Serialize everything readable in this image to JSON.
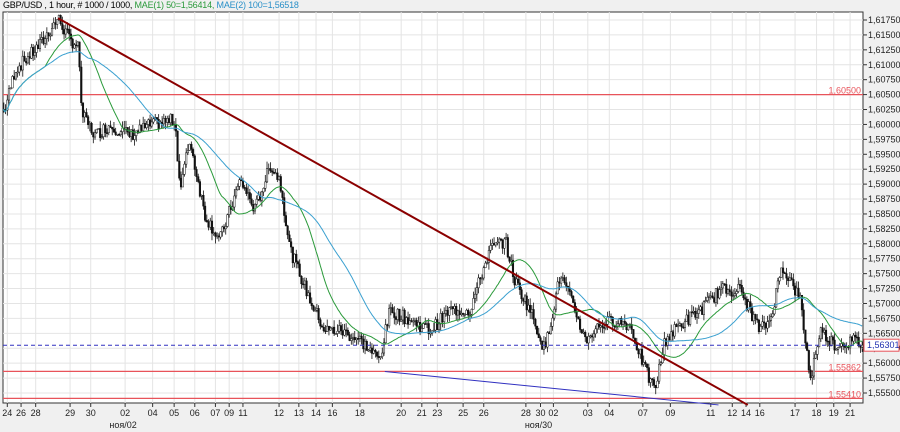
{
  "header": {
    "symbol_info": "GBP/USD , 1 hour, # 1000 / 1000,",
    "ma1": "MAE(1) 50=1,56414,",
    "ma2": "MAE(2) 100=1,56518"
  },
  "colors": {
    "ma50": "#2a9a3a",
    "ma100": "#3aa0d0",
    "trend": "#8b0000",
    "level": "#e8535a",
    "support": "#3030c0",
    "current": "#3030c0"
  },
  "chart_data": {
    "type": "candlestick",
    "title": "GBP/USD , 1 hour",
    "bars_total": 1000,
    "ylim": [
      1.5535,
      1.6195
    ],
    "y_ticks": [
      "1,61750",
      "1,61500",
      "1,61250",
      "1,61000",
      "1,60750",
      "1,60500",
      "1,60250",
      "1,60000",
      "1,59750",
      "1,59500",
      "1,59250",
      "1,59000",
      "1,58750",
      "1,58500",
      "1,58250",
      "1,58000",
      "1,57750",
      "1,57500",
      "1,57250",
      "1,57000",
      "1,56750",
      "1,56500",
      "1,56250",
      "1,56000",
      "1,55750",
      "1,55500"
    ],
    "y_tick_values": [
      1.6175,
      1.615,
      1.6125,
      1.61,
      1.6075,
      1.605,
      1.6025,
      1.6,
      1.5975,
      1.595,
      1.5925,
      1.59,
      1.5875,
      1.585,
      1.5825,
      1.58,
      1.5775,
      1.575,
      1.5725,
      1.57,
      1.5675,
      1.565,
      1.5625,
      1.56,
      1.5575,
      1.555
    ],
    "x_ticks": [
      {
        "bar": 5,
        "label": "24"
      },
      {
        "bar": 21,
        "label": "26"
      },
      {
        "bar": 38,
        "label": "28"
      },
      {
        "bar": 78,
        "label": "29"
      },
      {
        "bar": 102,
        "label": "30"
      },
      {
        "bar": 142,
        "label": "02",
        "sub": "ноя/02"
      },
      {
        "bar": 174,
        "label": "04"
      },
      {
        "bar": 199,
        "label": "05"
      },
      {
        "bar": 223,
        "label": "06"
      },
      {
        "bar": 247,
        "label": "07"
      },
      {
        "bar": 263,
        "label": "09"
      },
      {
        "bar": 279,
        "label": "11"
      },
      {
        "bar": 321,
        "label": "12"
      },
      {
        "bar": 344,
        "label": "13"
      },
      {
        "bar": 364,
        "label": "14"
      },
      {
        "bar": 383,
        "label": "16"
      },
      {
        "bar": 415,
        "label": "18"
      },
      {
        "bar": 463,
        "label": "20"
      },
      {
        "bar": 487,
        "label": "21"
      },
      {
        "bar": 505,
        "label": "23"
      },
      {
        "bar": 535,
        "label": "25"
      },
      {
        "bar": 559,
        "label": "26"
      },
      {
        "bar": 608,
        "label": "28"
      },
      {
        "bar": 625,
        "label": "30",
        "sub": "ноя/30"
      },
      {
        "bar": 640,
        "label": "02"
      },
      {
        "bar": 680,
        "label": "03"
      },
      {
        "bar": 705,
        "label": "04"
      },
      {
        "bar": 744,
        "label": "07"
      },
      {
        "bar": 776,
        "label": "09"
      },
      {
        "bar": 823,
        "label": "11"
      },
      {
        "bar": 848,
        "label": "12"
      },
      {
        "bar": 864,
        "label": "14"
      },
      {
        "bar": 880,
        "label": "16"
      },
      {
        "bar": 921,
        "label": "17"
      },
      {
        "bar": 946,
        "label": "18"
      },
      {
        "bar": 966,
        "label": "19"
      },
      {
        "bar": 985,
        "label": "21"
      }
    ],
    "price_path": [
      [
        2,
        1.6024
      ],
      [
        14,
        1.6091
      ],
      [
        43,
        1.6133
      ],
      [
        64,
        1.6178
      ],
      [
        78,
        1.6141
      ],
      [
        87,
        1.6133
      ],
      [
        92,
        1.6016
      ],
      [
        107,
        1.5982
      ],
      [
        124,
        1.5999
      ],
      [
        148,
        1.5982
      ],
      [
        171,
        1.5999
      ],
      [
        200,
        1.6008
      ],
      [
        206,
        1.589
      ],
      [
        217,
        1.5974
      ],
      [
        235,
        1.5848
      ],
      [
        252,
        1.5806
      ],
      [
        276,
        1.5907
      ],
      [
        293,
        1.5857
      ],
      [
        311,
        1.5932
      ],
      [
        322,
        1.5907
      ],
      [
        334,
        1.579
      ],
      [
        357,
        1.5706
      ],
      [
        374,
        1.5655
      ],
      [
        392,
        1.5655
      ],
      [
        415,
        1.5639
      ],
      [
        438,
        1.5605
      ],
      [
        450,
        1.5689
      ],
      [
        473,
        1.5672
      ],
      [
        497,
        1.5655
      ],
      [
        520,
        1.5689
      ],
      [
        543,
        1.5689
      ],
      [
        566,
        1.579
      ],
      [
        584,
        1.5806
      ],
      [
        595,
        1.5739
      ],
      [
        613,
        1.5689
      ],
      [
        630,
        1.5622
      ],
      [
        648,
        1.5748
      ],
      [
        665,
        1.5689
      ],
      [
        677,
        1.5639
      ],
      [
        694,
        1.5664
      ],
      [
        712,
        1.5672
      ],
      [
        729,
        1.5664
      ],
      [
        747,
        1.5588
      ],
      [
        758,
        1.5555
      ],
      [
        770,
        1.5639
      ],
      [
        787,
        1.5664
      ],
      [
        811,
        1.5689
      ],
      [
        834,
        1.5723
      ],
      [
        857,
        1.5723
      ],
      [
        880,
        1.5655
      ],
      [
        892,
        1.5672
      ],
      [
        906,
        1.5764
      ],
      [
        927,
        1.5706
      ],
      [
        939,
        1.5572
      ],
      [
        950,
        1.5655
      ],
      [
        968,
        1.563
      ],
      [
        991,
        1.5638
      ],
      [
        1000,
        1.563
      ]
    ],
    "series": [
      {
        "name": "MAE(1) 50",
        "period": 50,
        "last": 1.56414
      },
      {
        "name": "MAE(2) 100",
        "period": 100,
        "last": 1.56518
      }
    ],
    "levels": [
      {
        "price": 1.605,
        "label": "1,60500"
      },
      {
        "price": 1.55862,
        "label": "1,55862"
      },
      {
        "price": 1.5541,
        "label": "1,55410"
      }
    ],
    "current_price": {
      "price": 1.56301,
      "label": "1,56301"
    },
    "trendline": [
      [
        64,
        1.6178
      ],
      [
        866,
        1.553
      ]
    ],
    "support_line": [
      [
        444,
        1.5586
      ],
      [
        832,
        1.553
      ]
    ]
  }
}
